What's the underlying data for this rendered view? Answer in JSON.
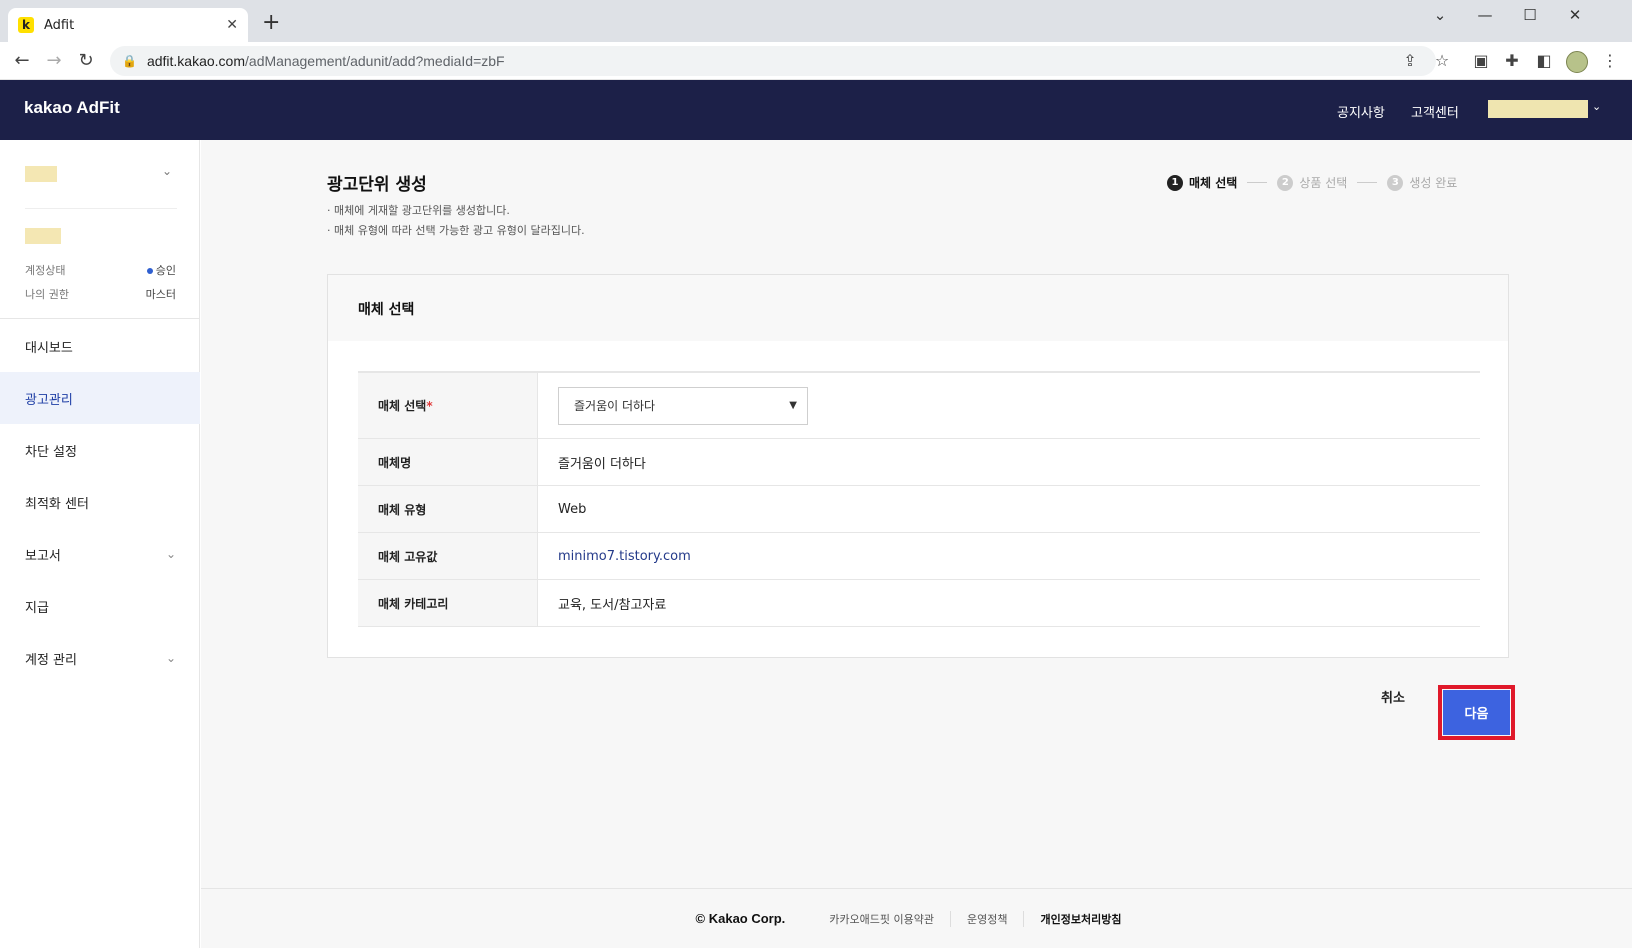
{
  "browser": {
    "tab_favicon": "k",
    "tab_title": "Adfit",
    "close_glyph": "✕",
    "new_tab_glyph": "+",
    "url_host": "adfit.kakao.com",
    "url_path": "/adManagement/adunit/add?mediaId=zbF"
  },
  "header": {
    "logo": "kakao AdFit",
    "notice": "공지사항",
    "support": "고객센터"
  },
  "sidebar": {
    "account_status_label": "계정상태",
    "account_status_value": "승인",
    "my_role_label": "나의 권한",
    "my_role_value": "마스터",
    "items": [
      {
        "label": "대시보드"
      },
      {
        "label": "광고관리"
      },
      {
        "label": "차단 설정"
      },
      {
        "label": "최적화 센터"
      },
      {
        "label": "보고서"
      },
      {
        "label": "지급"
      },
      {
        "label": "계정 관리"
      }
    ]
  },
  "page": {
    "title": "광고단위 생성",
    "desc1": "· 매체에 게재할 광고단위를 생성합니다.",
    "desc2": "· 매체 유형에 따라 선택 가능한 광고 유형이 달라집니다.",
    "steps": [
      {
        "num": "1",
        "label": "매체 선택"
      },
      {
        "num": "2",
        "label": "상품 선택"
      },
      {
        "num": "3",
        "label": "생성 완료"
      }
    ]
  },
  "card": {
    "title": "매체 선택",
    "rows": {
      "select_label": "매체 선택",
      "required_mark": "*",
      "select_value": "즐거움이 더하다",
      "name_label": "매체명",
      "name_value": "즐거움이 더하다",
      "type_label": "매체 유형",
      "type_value": "Web",
      "id_label": "매체 고유값",
      "id_value": "minimo7.tistory.com",
      "category_label": "매체 카테고리",
      "category_value": "교육, 도서/참고자료"
    }
  },
  "actions": {
    "cancel": "취소",
    "next": "다음"
  },
  "footer": {
    "copyright": "© Kakao Corp.",
    "terms": "카카오애드핏 이용약관",
    "policy": "운영정책",
    "privacy": "개인정보처리방침"
  },
  "colors": {
    "header_bg": "#1c2048",
    "primary": "#3d63e0",
    "highlight_border": "#e0192a"
  }
}
